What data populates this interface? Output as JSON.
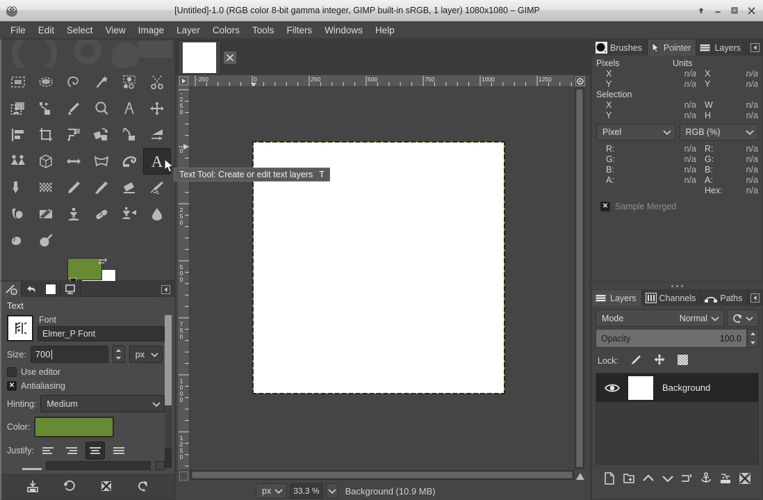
{
  "window": {
    "title": "[Untitled]-1.0 (RGB color 8-bit gamma integer, GIMP built-in sRGB, 1 layer) 1080x1080 – GIMP",
    "controls": [
      "roll-up",
      "minimize",
      "maximize",
      "close"
    ]
  },
  "menubar": {
    "items": [
      "File",
      "Edit",
      "Select",
      "View",
      "Image",
      "Layer",
      "Colors",
      "Tools",
      "Filters",
      "Windows",
      "Help"
    ]
  },
  "toolbox": {
    "rows": [
      [
        "rect-select-icon",
        "ellipse-select-icon",
        "free-select-icon",
        "fuzzy-select-icon",
        "select-by-color-icon",
        "scissors-select-icon"
      ],
      [
        "foreground-select-icon",
        "paths-icon",
        "color-picker-icon",
        "zoom-icon",
        "measure-icon",
        "move-icon"
      ],
      [
        "alignment-icon",
        "crop-icon",
        "rotate-icon",
        "scale-icon",
        "shear-icon",
        "perspective-icon"
      ],
      [
        "flip-icon",
        "handle-transform-icon",
        "cage-transform-icon",
        "warp-transform-icon",
        "bucket-fill-icon",
        "text-icon"
      ],
      [
        "gradient-icon",
        "pattern-icon",
        "pencil-icon",
        "paintbrush-icon",
        "eraser-icon",
        "airbrush-icon"
      ],
      [
        "ink-icon",
        "mypaint-brush-icon",
        "clone-icon",
        "heal-icon",
        "perspective-clone-icon",
        "blur-sharpen-icon"
      ],
      [
        "smudge-icon",
        "dodge-burn-icon"
      ]
    ],
    "active_tool": "text-icon",
    "foreground_color": "#678a33",
    "background_color": "#ffffff"
  },
  "tooltip": {
    "text": "Text Tool: Create or edit text layers",
    "shortcut": "T"
  },
  "tool_options": {
    "dock_tabs": [
      "tool-options-icon",
      "undo-history-icon",
      "device-status-icon",
      "images-icon"
    ],
    "selected_dock_tab": "images-icon",
    "title": "Text",
    "font_label": "Font",
    "font_value": "Elmer_P Font",
    "size_label": "Size:",
    "size_value": "700",
    "size_unit": "px",
    "use_editor_label": "Use editor",
    "use_editor_checked": false,
    "antialiasing_label": "Antialiasing",
    "antialiasing_checked": true,
    "hinting_label": "Hinting:",
    "hinting_value": "Medium",
    "color_label": "Color:",
    "color_value": "#678a33",
    "justify_label": "Justify:",
    "justify_options": [
      "left",
      "right",
      "center",
      "fill"
    ],
    "justify_selected": "center",
    "footer_buttons": [
      "save-options-icon",
      "restore-options-icon",
      "delete-options-icon",
      "reset-options-icon"
    ]
  },
  "image_tabs": {
    "thumbnail_label": "untitled-thumbnail",
    "close_label": "close-icon"
  },
  "rulers": {
    "horizontal_ticks": [
      "-250",
      "0",
      "250",
      "500",
      "750",
      "1000",
      "1250"
    ],
    "vertical_ticks": [
      "-250",
      "0",
      "250",
      "500",
      "750",
      "1000",
      "1250"
    ]
  },
  "statusbar": {
    "unit": "px",
    "zoom": "33.3 %",
    "text": "Background (10.9 MB)"
  },
  "pointer_dock": {
    "tabs": [
      {
        "label": "Brushes",
        "icon": "brushes-icon",
        "selected": false
      },
      {
        "label": "Pointer",
        "icon": "pointer-icon",
        "selected": true
      },
      {
        "label": "Layers",
        "icon": "layers-icon",
        "selected": false
      }
    ],
    "pixels_header": "Pixels",
    "units_header": "Units",
    "pixels_x_label": "X",
    "pixels_x_value": "n/a",
    "pixels_y_label": "Y",
    "pixels_y_value": "n/a",
    "units_x_label": "X",
    "units_x_value": "n/a",
    "units_y_label": "Y",
    "units_y_value": "n/a",
    "selection_header": "Selection",
    "sel_x_label": "X",
    "sel_x_value": "n/a",
    "sel_y_label": "Y",
    "sel_y_value": "n/a",
    "sel_w_label": "W",
    "sel_w_value": "n/a",
    "sel_h_label": "H",
    "sel_h_value": "n/a",
    "unit_combo": "Pixel",
    "color_combo": "RGB (%)",
    "channels": [
      {
        "label": "R:",
        "left": "n/a",
        "right_label": "R:",
        "right": "n/a"
      },
      {
        "label": "G:",
        "left": "n/a",
        "right_label": "G:",
        "right": "n/a"
      },
      {
        "label": "B:",
        "left": "n/a",
        "right_label": "B:",
        "right": "n/a"
      },
      {
        "label": "A:",
        "left": "n/a",
        "right_label": "A:",
        "right": "n/a"
      }
    ],
    "hex_label": "Hex:",
    "hex_value": "n/a",
    "sample_merged_label": "Sample Merged",
    "sample_merged_checked": true
  },
  "layers_dock": {
    "tabs": [
      {
        "label": "Layers",
        "icon": "layers-icon",
        "selected": true
      },
      {
        "label": "Channels",
        "icon": "channels-icon",
        "selected": false
      },
      {
        "label": "Paths",
        "icon": "paths-icon",
        "selected": false
      }
    ],
    "mode_label": "Mode",
    "mode_value": "Normal",
    "opacity_label": "Opacity",
    "opacity_value": "100.0",
    "lock_label": "Lock:",
    "lock_icons": [
      "lock-pixels-icon",
      "lock-position-icon",
      "lock-alpha-icon"
    ],
    "layers": [
      {
        "name": "Background",
        "visible": true,
        "selected": true
      }
    ],
    "footer_buttons": [
      "new-layer-icon",
      "new-group-icon",
      "raise-layer-icon",
      "lower-layer-icon",
      "duplicate-layer-icon",
      "anchor-layer-icon",
      "merge-down-icon",
      "delete-layer-icon"
    ]
  }
}
